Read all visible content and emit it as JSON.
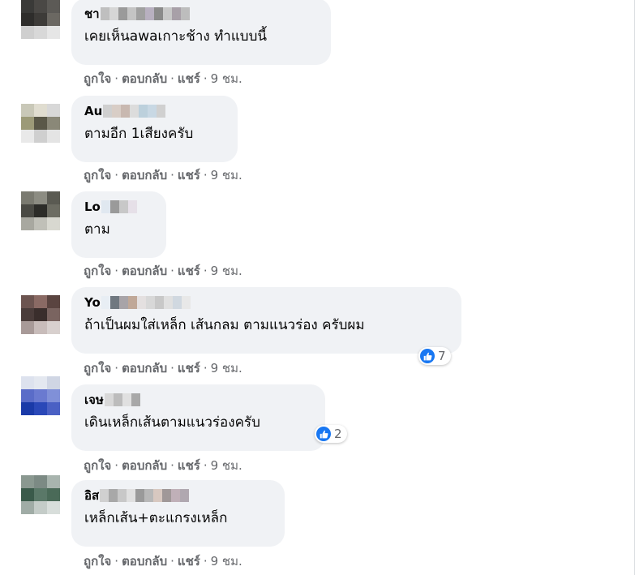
{
  "actions": {
    "like": "ถูกใจ",
    "reply": "ตอบกลับ",
    "share": "แชร์",
    "separator": "·"
  },
  "comments": [
    {
      "author": "ชา",
      "text": "เคยเห็นawaเกาะช้าง ทำแบบนี้",
      "time": "9 ชม.",
      "avatar_colors": [
        "#3a3a38",
        "#4a4845",
        "#5c5a56",
        "#2e2d2b",
        "#3d3b38",
        "#6b6862",
        "#cfcfcf",
        "#d8d8d8",
        "#e6e6e6"
      ],
      "blur_colors": [
        "#bfbfbf",
        "#d6d6d6",
        "#9a9a9a",
        "#c4c4c4",
        "#a0a0a0",
        "#b8b0c0",
        "#8a8a8a",
        "#c8c8c8",
        "#a8a0a8",
        "#bdbdbd"
      ]
    },
    {
      "author": "Au",
      "text": "ตามอีก 1เสียงครับ",
      "time": "9 ชม.",
      "avatar_colors": [
        "#c9c8b8",
        "#e0ddd0",
        "#d8d8d8",
        "#9c9a78",
        "#5a5848",
        "#8a8878",
        "#e9e9e9",
        "#cfcfcf",
        "#e4e4e4"
      ],
      "blur_colors": [
        "#cfcfcf",
        "#d8cdc6",
        "#c8b8b0",
        "#dcdcdc",
        "#bcd0dc",
        "#c8d8e4",
        "#d0d0d0"
      ]
    },
    {
      "author": "Lo",
      "text": "ตาม",
      "time": "9 ชม.",
      "avatar_colors": [
        "#7a7a70",
        "#8c8c82",
        "#5a5a52",
        "#4a4a44",
        "#2c2c28",
        "#6c6c62",
        "#a8a8a0",
        "#c0c0b8",
        "#d8d8d0"
      ],
      "blur_colors": [
        "#e0e8f0",
        "#9a9a9a",
        "#c8c8c8",
        "#e6e0e8"
      ]
    },
    {
      "author": "Yo",
      "text": "ถ้าเป็นผมใส่เหล็ก เส้นกลม ตามแนวร่อง ครับผม",
      "time": "9 ชม.",
      "likes": "7",
      "avatar_colors": [
        "#6c5450",
        "#8a6a64",
        "#5a4440",
        "#4a3c3a",
        "#3a2e2c",
        "#7a6460",
        "#a89a98",
        "#c8bcba",
        "#d8d0ce"
      ],
      "blur_colors": [
        "#e8eef4",
        "#707880",
        "#a8a4a8",
        "#c0a898",
        "#e4e0e0",
        "#d8d8d8",
        "#c8c8c8",
        "#e0e0e0",
        "#d0d8e0",
        "#e8e8e8"
      ]
    },
    {
      "author": "เจษ",
      "text": "เดินเหล็กเส้นตามแนวร่องครับ",
      "time": "9 ชม.",
      "likes": "2",
      "avatar_colors": [
        "#dde2ee",
        "#e4e8f0",
        "#d0d6e4",
        "#5a6cc8",
        "#6a7ad0",
        "#8090d8",
        "#1a3aa8",
        "#2a48b8",
        "#4a60c4"
      ],
      "blur_colors": [
        "#d8d8d8",
        "#bcbcbc",
        "#e0e0e0",
        "#a8a8a8"
      ]
    },
    {
      "author": "อิส",
      "text": "เหล็กเส้น+ตะแกรงเหล็ก",
      "time": "9 ชม.",
      "avatar_colors": [
        "#8a9890",
        "#7c8a84",
        "#a8b4ae",
        "#3a5a4a",
        "#5a7868",
        "#4a6a58",
        "#a0aca6",
        "#c4ccc8",
        "#d8dedb"
      ],
      "blur_colors": [
        "#d0d0d0",
        "#a8a8a8",
        "#c8c8c8",
        "#e0e0e0",
        "#9a9a9a",
        "#b8b8b8",
        "#d8c8c0",
        "#a09898",
        "#c0b0b8",
        "#b0a8b0"
      ]
    }
  ]
}
